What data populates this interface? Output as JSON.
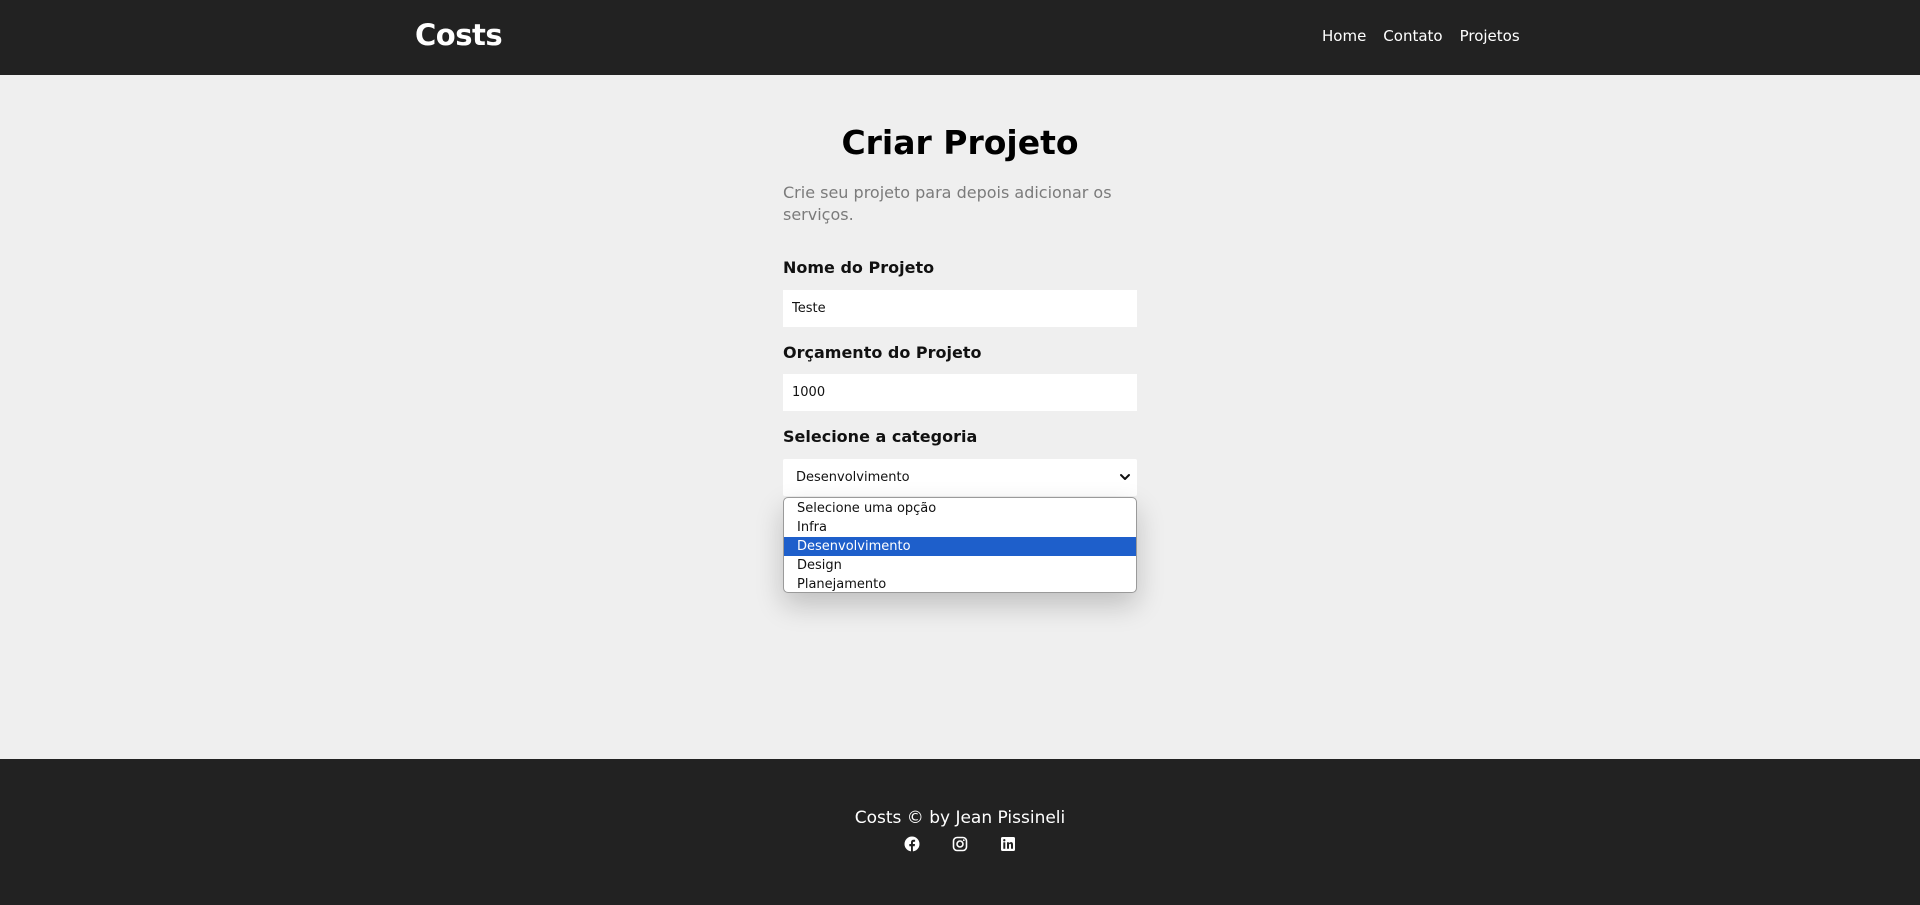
{
  "navbar": {
    "brand": "Costs",
    "links": [
      "Home",
      "Contato",
      "Projetos"
    ]
  },
  "page": {
    "title": "Criar Projeto",
    "subtitle": "Crie seu projeto para depois adicionar os serviços."
  },
  "form": {
    "name_label": "Nome do Projeto",
    "name_value": "Teste",
    "budget_label": "Orçamento do Projeto",
    "budget_value": "1000",
    "category_label": "Selecione a categoria",
    "category_selected": "Desenvolvimento",
    "category_options": [
      "Selecione uma opção",
      "Infra",
      "Desenvolvimento",
      "Design",
      "Planejamento"
    ],
    "highlighted_option_color": "#1e5fcb"
  },
  "footer": {
    "text": "Costs © by Jean Pissineli",
    "social_icons": [
      "facebook-icon",
      "instagram-icon",
      "linkedin-icon"
    ]
  },
  "colors": {
    "navbar_bg": "#222222",
    "page_bg": "#efefef",
    "subtitle": "#7b7b7b"
  }
}
